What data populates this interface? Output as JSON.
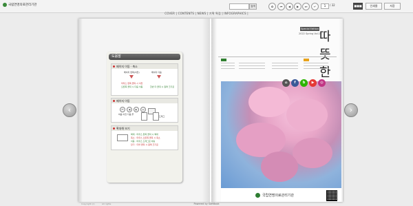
{
  "header": {
    "org_name": "국립연명의료관리기관",
    "search_label": "검색",
    "page_current": "1",
    "page_total": "/ 32",
    "view_mode": "■■■",
    "print_label": "인쇄물",
    "save_label": "저장"
  },
  "menu": {
    "items": "COVER | CONTENTS | NEWS | 기획 특집 | INFOGRAPHICS |"
  },
  "guide": {
    "title": "도움말",
    "sec1_title": "페이지 이동 · 축소",
    "sec1_left_top": "페이지 왼쪽(이전)",
    "sec1_right_top": "페이지 다음",
    "sec1_left_red": "마우스 왼쪽 클릭 시 이전",
    "sec1_left_green": "오른쪽 클릭 시 다음 이동",
    "sec1_right_red": "클릭 시 축소",
    "sec1_right_green": "한번 더 클릭 시 원래 크기로",
    "sec2_title": "페이지 이동",
    "sec2_labels": "처음  이전  다음  끝",
    "sec2_zoom_label": "확대/축소",
    "sec2_drag_label": "드래그",
    "sec3_title": "확대해 보기",
    "sec3_line1": "확대 : 마우스 왼쪽 클릭 시 확대",
    "sec3_line2": "축소 : 마우스 오른쪽 클릭 시 축소",
    "sec3_line3": "이동 : 마우스 드래그로 이동",
    "sec3_line4": "닫기 : 더블 클릭 시 원래 크기로"
  },
  "magazine": {
    "tag": "Special Edition",
    "subtitle": "2022 Spring Vol.19",
    "title": "따뜻한 동행",
    "footer_org": "국립연명의료관리기관"
  },
  "footer": {
    "powered": "Powered by SoftBook",
    "copy1": "Copyright (c)",
    "copy2": "All rights"
  },
  "colors": {
    "accent_green": "#2f7f2f",
    "accent_red": "#c53030",
    "youtube_red": "#e53935",
    "facebook_blue": "#3b5998",
    "blog_green": "#2db400",
    "insta_pink": "#c13584"
  }
}
